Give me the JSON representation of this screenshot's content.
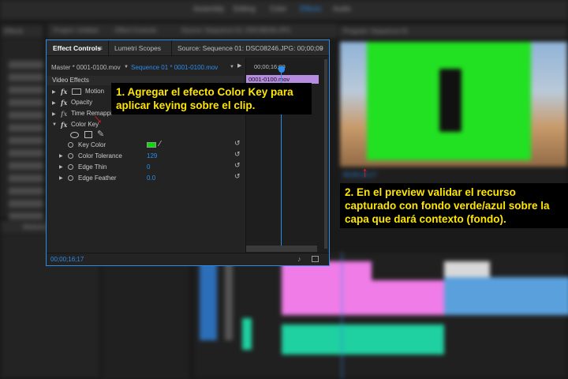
{
  "background": {
    "workspace_tabs": [
      "Assembly",
      "Editing",
      "Color",
      "Effects",
      "Audio"
    ],
    "active_workspace": "Effects",
    "left_panel_tabs": [
      "Effects",
      "Project: Untitled",
      "Effect Controls",
      "Source: Sequence 01: DSC08246.JPG"
    ],
    "program_monitor_title": "Program: Sequence 01",
    "program_timecode": "00;00;16;17",
    "markers_tab": "Markers"
  },
  "effect_controls": {
    "tabs": [
      "Effect Controls",
      "Lumetri Scopes",
      "Source: Sequence 01: DSC08246.JPG: 00;00;09"
    ],
    "menu_icon": "hamburger-icon",
    "overflow_icon": "double-chevron-right-icon",
    "master_label": "Master * 0001-0100.mov",
    "sequence_label": "Sequence 01 * 0001-0100.mov",
    "timecode_ruler": "00;00;16;00",
    "clip_label": "0001-0100.mov",
    "video_effects_header": "Video Effects",
    "effects": [
      "Motion",
      "Opacity",
      "Time Remapping",
      "Color Key"
    ],
    "color_key_props": [
      {
        "label": "Key Color",
        "value": ""
      },
      {
        "label": "Color Tolerance",
        "value": "129"
      },
      {
        "label": "Edge Thin",
        "value": "0"
      },
      {
        "label": "Edge Feather",
        "value": "0.0"
      }
    ],
    "key_color_hex": "#00e000",
    "current_timecode": "00;00;16;17"
  },
  "annotations": {
    "note1": "1. Agregar el efecto Color Key para aplicar keying sobre el clip.",
    "note2": "2. En el preview validar el recurso capturado con fondo verde/azul sobre la capa que dará contexto (fondo)."
  },
  "colors": {
    "accent": "#2d8ceb",
    "note_text": "#ffe600",
    "arrow": "#e02020",
    "chroma_green": "#22e022",
    "clip_pink": "#f07ce8",
    "clip_blue": "#5aa0dc",
    "audio_green": "#1fd0a0"
  }
}
